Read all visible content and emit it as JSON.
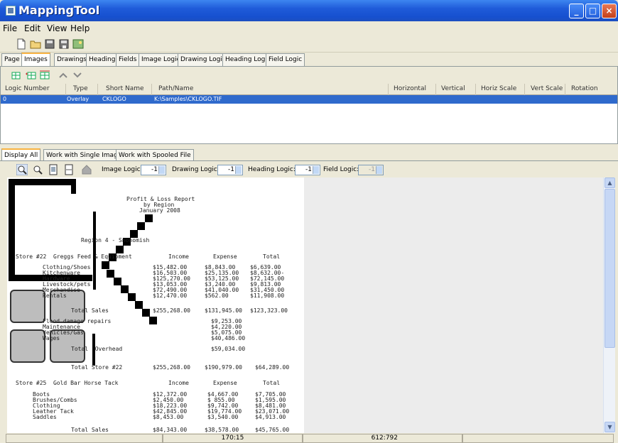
{
  "window": {
    "title": "MappingTool"
  },
  "menu": [
    "File",
    "Edit",
    "View",
    "Help"
  ],
  "main_tabs": [
    {
      "label": "Page"
    },
    {
      "label": "Images"
    },
    {
      "label": "Drawings"
    },
    {
      "label": "Headings"
    },
    {
      "label": "Fields"
    },
    {
      "label": "Image Logic"
    },
    {
      "label": "Drawing Logic"
    },
    {
      "label": "Heading Logic"
    },
    {
      "label": "Field Logic"
    }
  ],
  "table": {
    "columns": [
      "Logic Number",
      "Type",
      "Short Name",
      "Path/Name",
      "Horizontal",
      "Vertical",
      "Horiz Scale",
      "Vert Scale",
      "Rotation"
    ],
    "rows": [
      {
        "logic": "0",
        "type": "Overlay",
        "short": "CKLOGO",
        "path": "K:\\Samples\\CKLOGO.TIF"
      }
    ]
  },
  "view_tabs": [
    "Display All",
    "Work with Single Image",
    "Work with Spooled File"
  ],
  "controls": {
    "image_logic_label": "Image Logic:",
    "image_logic": "-1",
    "drawing_logic_label": "Drawing Logic:",
    "drawing_logic": "-1",
    "heading_logic_label": "Heading Logic:",
    "heading_logic": "-1",
    "field_logic_label": "Field Logic:",
    "field_logic": "-1"
  },
  "report": {
    "title1": "Profit & Loss Report",
    "title2": "by Region",
    "title3": "January 2008",
    "region": "Region 4 - Snohomish",
    "store1_header": "Store #22  Greggs Feed & Equipment",
    "col_income": "Income",
    "col_expense": "Expense",
    "col_total": "Total",
    "store1_lines": [
      [
        "Clothing/Shoes",
        "$15,482.00",
        "$8,843.00",
        "$6,639.00"
      ],
      [
        "Kitchenware",
        "$16,503.00",
        "$25,135.00",
        "$8,632.00-"
      ],
      [
        "Hardware",
        "$125,270.00",
        "$53,125.00",
        "$72,145.00"
      ],
      [
        "Livestock/pets",
        "$13,053.00",
        "$3,240.00",
        "$9,813.00"
      ],
      [
        "Merchandise",
        "$72,490.00",
        "$41,040.00",
        "$31,450.00"
      ],
      [
        "Rentals",
        "$12,470.00",
        "$562.00",
        "$11,908.00"
      ]
    ],
    "store1_total_sales": [
      "Total Sales",
      "$255,268.00",
      "$131,945.00",
      "$123,323.00"
    ],
    "overhead_lines": [
      [
        "Flood damage repairs",
        "$9,253.00"
      ],
      [
        "Maintenance",
        "$4,220.00"
      ],
      [
        "Vehicles/Gas",
        "$5,075.00"
      ],
      [
        "Wages",
        "$40,486.00"
      ]
    ],
    "total_overhead": [
      "Total  Overhead",
      "$59,034.00"
    ],
    "total_store1": [
      "Total Store #22",
      "$255,268.00",
      "$190,979.00",
      "$64,289.00"
    ],
    "store2_header": "Store #25  Gold Bar Horse Tack",
    "store2_lines": [
      [
        "Boots",
        "$12,372.00",
        "$4,667.00",
        "$7,705.00"
      ],
      [
        "Brushes/Combs",
        "$2,450.00",
        "$ 855.00",
        "$1,595.00"
      ],
      [
        "Clothing",
        "$18,223.00",
        "$9,742.00",
        "$8,481.00"
      ],
      [
        "Leather Tack",
        "$42,845.00",
        "$19,774.00",
        "$23,071.00"
      ],
      [
        "Saddles",
        "$8,453.00",
        "$3,540.00",
        "$4,913.00"
      ]
    ],
    "store2_total_sales": [
      "Total Sales",
      "$84,343.00",
      "$38,578.00",
      "$45,765.00"
    ]
  },
  "status": {
    "pos1": "170:15",
    "pos2": "612:792"
  },
  "colors": {
    "selection": "#2f6acc",
    "titlebar": "#1f5bd9"
  }
}
